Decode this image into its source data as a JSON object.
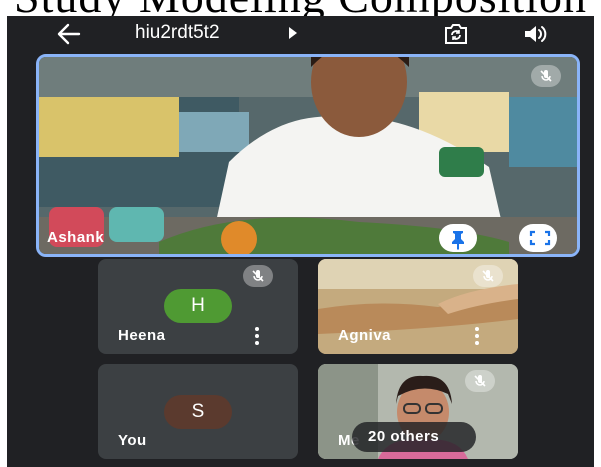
{
  "caption": "Study Modeling Composition",
  "header": {
    "back_icon": "arrow-left-icon",
    "meeting_code": "hiu2rdt5t2",
    "code_arrow_icon": "caret-right-icon",
    "switch_camera_icon": "switch-camera-icon",
    "speaker_icon": "speaker-icon"
  },
  "main_tile": {
    "participant_name": "Ashank",
    "mic_state": "muted",
    "pin_icon": "pin-icon",
    "fullscreen_icon": "fullscreen-icon",
    "active_speaker_highlight": "#8ab4f8"
  },
  "grid": {
    "tiles": [
      {
        "name": "Heena",
        "avatar_letter": "H",
        "avatar_color": "#4f9a33",
        "mic_state": "muted"
      },
      {
        "name": "Agniva",
        "video": true,
        "mic_state": "muted"
      },
      {
        "name": "You",
        "avatar_letter": "S",
        "avatar_color": "#5b3a2e",
        "mic_state": "off"
      },
      {
        "name": "Me",
        "video": true,
        "mic_state": "muted"
      }
    ],
    "others_label": "20 others"
  }
}
